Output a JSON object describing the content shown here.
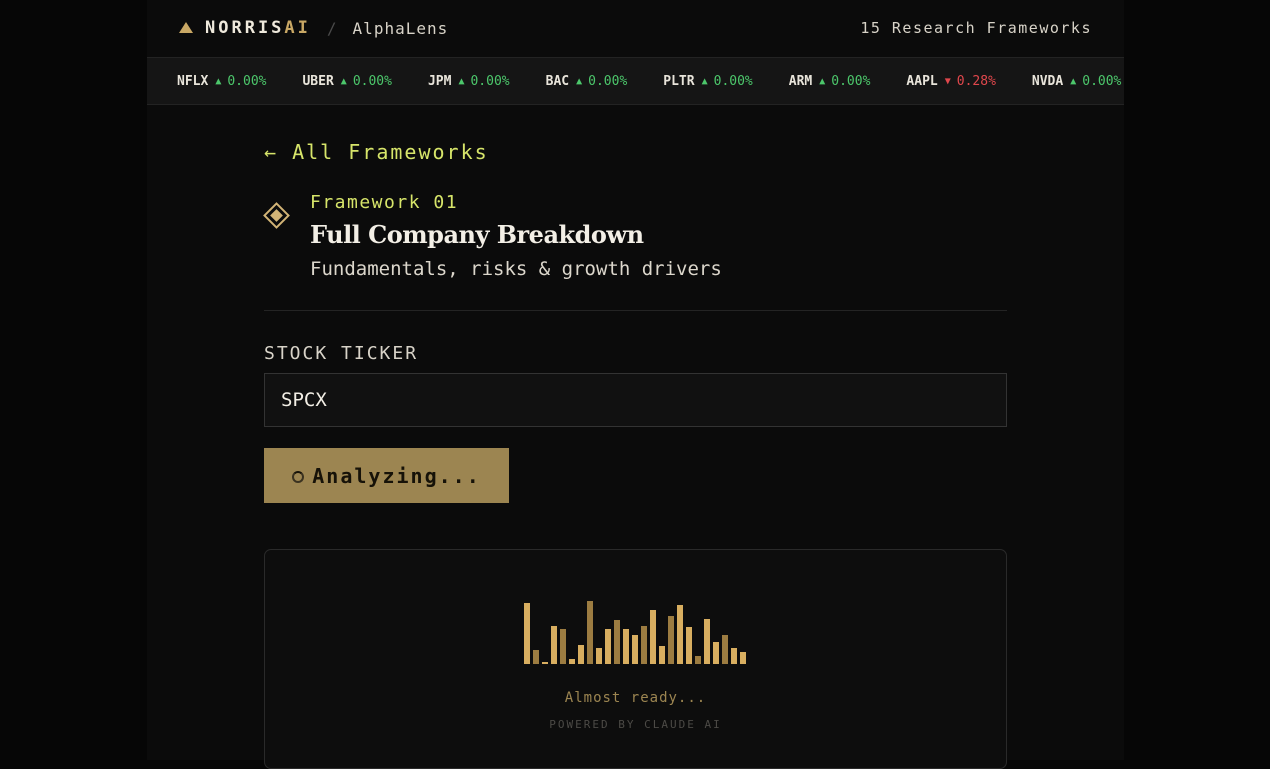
{
  "header": {
    "brand_main": "NORRIS",
    "brand_accent": "AI",
    "separator": "/",
    "product": "AlphaLens",
    "frameworks_count": "15 Research Frameworks"
  },
  "ticker": [
    {
      "symbol": "NFLX",
      "direction": "up",
      "change": "0.00%"
    },
    {
      "symbol": "UBER",
      "direction": "up",
      "change": "0.00%"
    },
    {
      "symbol": "JPM",
      "direction": "up",
      "change": "0.00%"
    },
    {
      "symbol": "BAC",
      "direction": "up",
      "change": "0.00%"
    },
    {
      "symbol": "PLTR",
      "direction": "up",
      "change": "0.00%"
    },
    {
      "symbol": "ARM",
      "direction": "up",
      "change": "0.00%"
    },
    {
      "symbol": "AAPL",
      "direction": "down",
      "change": "0.28%"
    },
    {
      "symbol": "NVDA",
      "direction": "up",
      "change": "0.00%"
    }
  ],
  "nav": {
    "back_label": "← All Frameworks"
  },
  "framework": {
    "number": "Framework 01",
    "title": "Full Company Breakdown",
    "subtitle": "Fundamentals, risks & growth drivers"
  },
  "form": {
    "label": "STOCK TICKER",
    "value": "SPCX",
    "button_label": "Analyzing..."
  },
  "loader": {
    "levels": [
      0.95,
      0.22,
      0.02,
      0.6,
      0.55,
      0.08,
      0.3,
      0.98,
      0.25,
      0.55,
      0.68,
      0.55,
      0.45,
      0.6,
      0.85,
      0.28,
      0.75,
      0.92,
      0.58,
      0.12,
      0.7,
      0.35,
      0.45,
      0.25,
      0.18
    ],
    "status": "Almost ready...",
    "powered_by": "POWERED BY CLAUDE AI"
  },
  "colors": {
    "accent_gold": "#c9a865",
    "accent_lime": "#d7e56a",
    "up": "#4cc76b",
    "down": "#e0474c"
  }
}
